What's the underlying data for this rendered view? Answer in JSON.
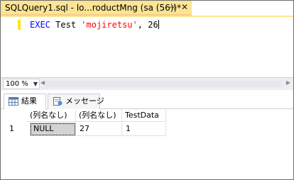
{
  "document_tab": {
    "title": "SQLQuery1.sql - lo...roductMng (sa (56))*",
    "pin_icon": "pin-icon",
    "close_icon": "close-icon"
  },
  "editor": {
    "keyword": "EXEC",
    "procedure": "Test",
    "string_arg": "'mojiretsu'",
    "separator": ",",
    "number_arg": "26"
  },
  "zoom": {
    "value": "100 %"
  },
  "result_tabs": [
    {
      "label": "結果",
      "icon": "grid-icon"
    },
    {
      "label": "メッセージ",
      "icon": "message-icon"
    }
  ],
  "grid": {
    "columns": [
      "(列名なし)",
      "(列名なし)",
      "TestData"
    ],
    "rows": [
      {
        "row_number": "1",
        "cells": [
          "NULL",
          "27",
          "1"
        ]
      }
    ]
  },
  "colors": {
    "tab_active": "#fbe494",
    "keyword": "#0000ff",
    "string": "#ff0000"
  }
}
